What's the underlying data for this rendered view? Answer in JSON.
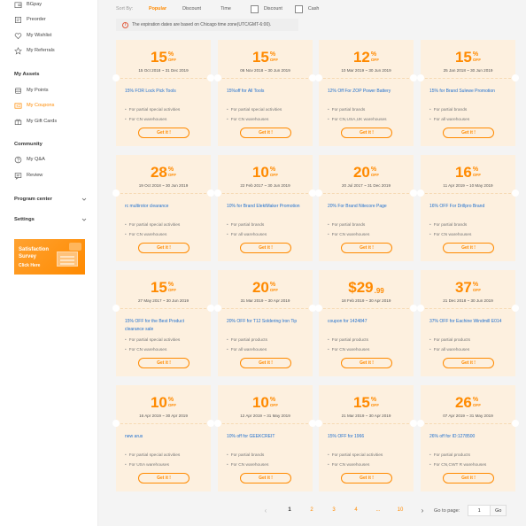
{
  "sidebar": {
    "top_items": [
      {
        "label": "BGpay",
        "icon": "wallet-icon"
      },
      {
        "label": "Preorder",
        "icon": "preorder-icon"
      },
      {
        "label": "My Wishlist",
        "icon": "heart-icon"
      },
      {
        "label": "My Referrals",
        "icon": "star-icon"
      }
    ],
    "assets_heading": "My Assets",
    "assets_items": [
      {
        "label": "My Points",
        "icon": "coins-icon"
      },
      {
        "label": "My Coupons",
        "icon": "coupon-icon"
      },
      {
        "label": "My Gift Cards",
        "icon": "gift-card-icon"
      }
    ],
    "community_heading": "Community",
    "community_items": [
      {
        "label": "My Q&A",
        "icon": "question-icon"
      },
      {
        "label": "Review",
        "icon": "review-icon"
      }
    ],
    "program_center": "Program center",
    "settings": "Settings",
    "survey": {
      "line1": "Satisfaction",
      "line2": "Survey",
      "link": "Click Here"
    }
  },
  "sortbar": {
    "label": "Sort By:",
    "options": [
      "Popular",
      "Discount",
      "Time"
    ],
    "active": "Popular",
    "filters": [
      "Discount",
      "Cash"
    ]
  },
  "notice": "The expiration dates are based on Chicago time zone(UTC/GMT-6:00).",
  "coupons": [
    {
      "value": "15",
      "unit": "%",
      "off": "OFF",
      "dates": "15 Oct 2018 ~ 31 Dec 2019",
      "title": "15% FOR Lock Pick Tools",
      "scope1": "For partial special activities",
      "scope2": "For CN warehouses",
      "button": "Get it !"
    },
    {
      "value": "15",
      "unit": "%",
      "off": "OFF",
      "dates": "06 Nov 2018 ~ 30 Jun 2019",
      "title": "15%off for All Tools",
      "scope1": "For partial special activities",
      "scope2": "For CN warehouses",
      "button": "Get it !"
    },
    {
      "value": "12",
      "unit": "%",
      "off": "OFF",
      "dates": "10 Mar 2019 ~ 30 Jun 2019",
      "title": "12% Off For ZOP Power Battery",
      "scope1": "For partial brands",
      "scope2": "For CN,USA,UK warehouses",
      "button": "Get it !"
    },
    {
      "value": "15",
      "unit": "%",
      "off": "OFF",
      "dates": "25 Jan 2018 ~ 30 Jun 2019",
      "title": "15% for Brand Sulewe Promotion",
      "scope1": "For partial brands",
      "scope2": "For all warehouses",
      "button": "Get it !"
    },
    {
      "value": "28",
      "unit": "%",
      "off": "OFF",
      "dates": "19 Oct 2018 ~ 30 Jun 2019",
      "title": "rc multirotor clearance",
      "scope1": "For partial special activities",
      "scope2": "For CN warehouses",
      "button": "Get it !"
    },
    {
      "value": "10",
      "unit": "%",
      "off": "OFF",
      "dates": "22 Feb 2017 ~ 30 Jun 2019",
      "title": "10% for Brand ElektMaker Promotion",
      "scope1": "For partial brands",
      "scope2": "For all warehouses",
      "button": "Get it !"
    },
    {
      "value": "20",
      "unit": "%",
      "off": "OFF",
      "dates": "20 Jul 2017 ~ 31 Dec 2019",
      "title": "20% For Brand Nitecore Page",
      "scope1": "For partial brands",
      "scope2": "For CN warehouses",
      "button": "Get it !"
    },
    {
      "value": "16",
      "unit": "%",
      "off": "OFF",
      "dates": "11 Apr 2019 ~ 10 May 2019",
      "title": "16% OFF For Drillpro Brand",
      "scope1": "For partial brands",
      "scope2": "For CN warehouses",
      "button": "Get it !"
    },
    {
      "value": "15",
      "unit": "%",
      "off": "OFF",
      "dates": "27 May 2017 ~ 30 Jun 2019",
      "title": "15% OFF for the Best Product clearance sale",
      "scope1": "For partial special activities",
      "scope2": "For CN warehouses",
      "button": "Get it !"
    },
    {
      "value": "20",
      "unit": "%",
      "off": "OFF",
      "dates": "31 Mar 2019 ~ 30 Apr 2019",
      "title": "20% OFF for T12 Soldering Iron Tip",
      "scope1": "For partial products",
      "scope2": "For all warehouses",
      "button": "Get it !"
    },
    {
      "value": "$29",
      "unit": ".99",
      "off": "",
      "dates": "18 Feb 2019 ~ 30 Apr 2019",
      "title": "coupon for 1424847",
      "scope1": "For partial products",
      "scope2": "For CN warehouses",
      "button": "Get it !"
    },
    {
      "value": "37",
      "unit": "%",
      "off": "OFF",
      "dates": "21 Dec 2018 ~ 30 Jun 2019",
      "title": "37% OFF for Eachine Windmill E014",
      "scope1": "For partial products",
      "scope2": "For all warehouses",
      "button": "Get it !"
    },
    {
      "value": "10",
      "unit": "%",
      "off": "OFF",
      "dates": "16 Apr 2019 ~ 30 Apr 2019",
      "title": "new arus",
      "scope1": "For partial special activities",
      "scope2": "For USA warehouses",
      "button": "Get it !"
    },
    {
      "value": "10",
      "unit": "%",
      "off": "OFF",
      "dates": "12 Apr 2019 ~ 31 May 2019",
      "title": "10% off for GEEKCREIT",
      "scope1": "For partial brands",
      "scope2": "For CN warehouses",
      "button": "Get it !"
    },
    {
      "value": "15",
      "unit": "%",
      "off": "OFF",
      "dates": "21 Mar 2019 ~ 30 Apr 2019",
      "title": "15% OFF for 1966",
      "scope1": "For partial special activities",
      "scope2": "For CN warehouses",
      "button": "Get it !"
    },
    {
      "value": "26",
      "unit": "%",
      "off": "OFF",
      "dates": "07 Apr 2019 ~ 31 May 2019",
      "title": "26% off for ID:1278500",
      "scope1": "For partial products",
      "scope2": "For CN,CWT R warehouses",
      "button": "Get it !"
    }
  ],
  "pagination": {
    "prev": "‹",
    "pages": [
      "1",
      "2",
      "3",
      "4",
      "...",
      "10"
    ],
    "current": "1",
    "next": "›",
    "goto_label": "Go to page:",
    "goto_value": "1",
    "goto_button": "Go"
  },
  "colors": {
    "accent": "#ff8a00",
    "link": "#1e6fcf",
    "coupon_bg": "#fdf0df"
  }
}
